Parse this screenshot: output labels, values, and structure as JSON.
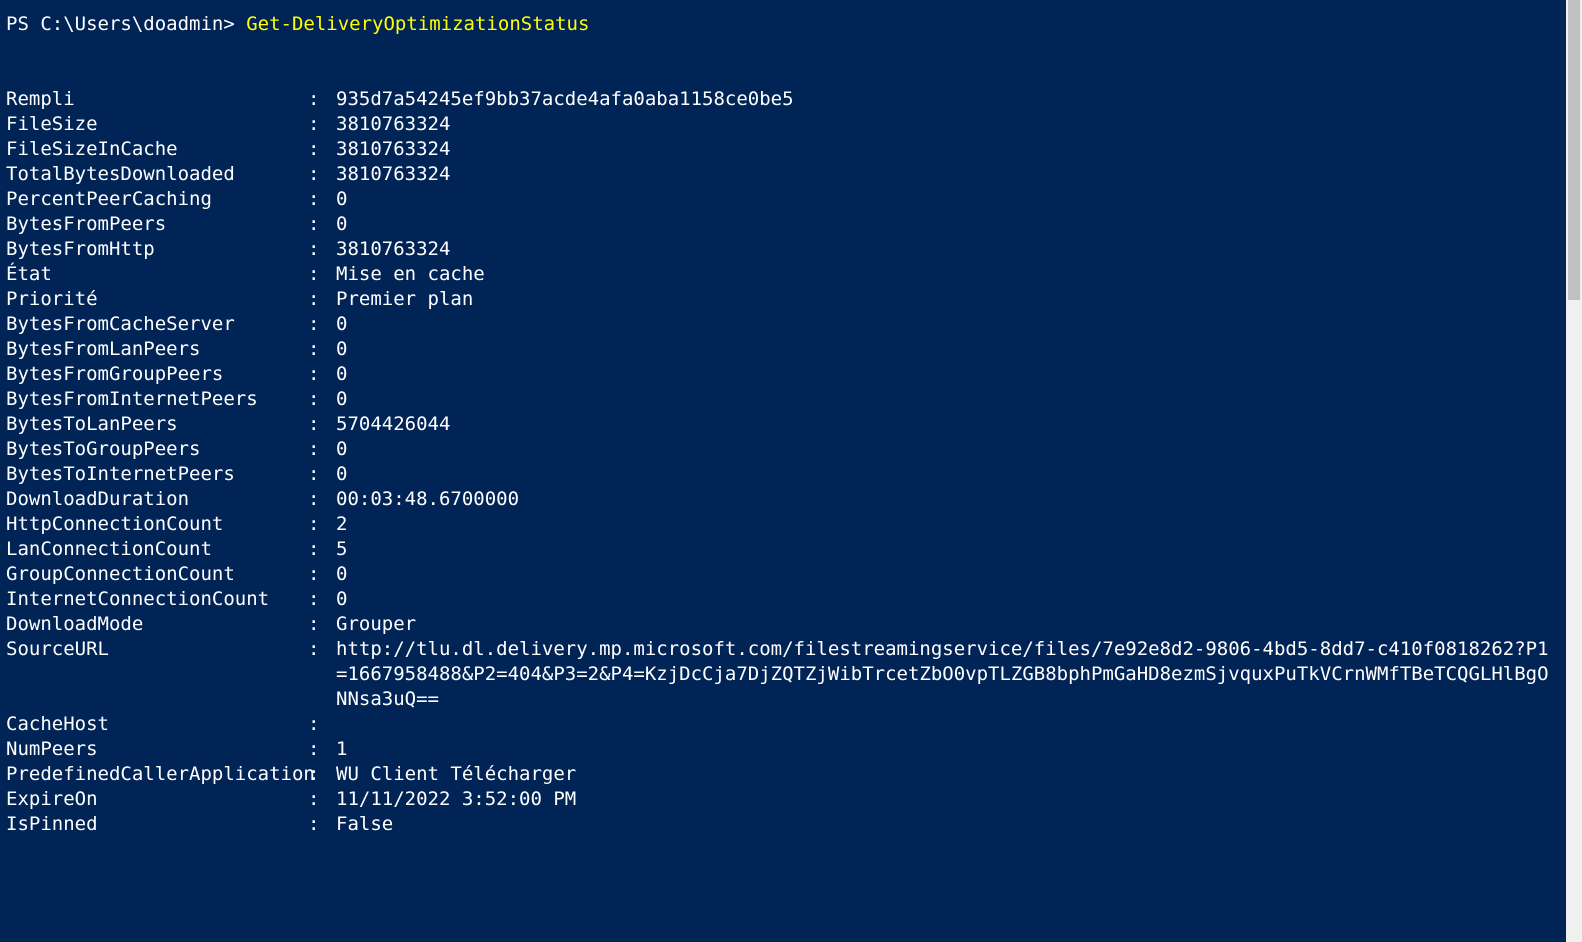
{
  "prompt": {
    "path": "PS C:\\Users\\doadmin> ",
    "command": "Get-DeliveryOptimizationStatus"
  },
  "records": [
    {
      "key": "Rempli",
      "value": "935d7a54245ef9bb37acde4afa0aba1158ce0be5"
    },
    {
      "key": "FileSize",
      "value": "3810763324"
    },
    {
      "key": "FileSizeInCache",
      "value": "3810763324"
    },
    {
      "key": "TotalBytesDownloaded",
      "value": "3810763324"
    },
    {
      "key": "PercentPeerCaching",
      "value": "0"
    },
    {
      "key": "BytesFromPeers",
      "value": "0"
    },
    {
      "key": "BytesFromHttp",
      "value": "3810763324"
    },
    {
      "key": "État",
      "value": "Mise en cache"
    },
    {
      "key": "Priorité",
      "value": " Premier plan"
    },
    {
      "key": "BytesFromCacheServer",
      "value": "0"
    },
    {
      "key": "BytesFromLanPeers",
      "value": "0"
    },
    {
      "key": "BytesFromGroupPeers",
      "value": "0"
    },
    {
      "key": "BytesFromInternetPeers",
      "value": "0"
    },
    {
      "key": "BytesToLanPeers",
      "value": "5704426044"
    },
    {
      "key": "BytesToGroupPeers",
      "value": "0"
    },
    {
      "key": "BytesToInternetPeers",
      "value": "0"
    },
    {
      "key": "DownloadDuration",
      "value": "00:03:48.6700000"
    },
    {
      "key": "HttpConnectionCount",
      "value": "2"
    },
    {
      "key": "LanConnectionCount",
      "value": "5"
    },
    {
      "key": "GroupConnectionCount",
      "value": "0"
    },
    {
      "key": "InternetConnectionCount",
      "value": "0"
    },
    {
      "key": "DownloadMode",
      "value": "Grouper"
    },
    {
      "key": "SourceURL",
      "value": "http://tlu.dl.delivery.mp.microsoft.com/filestreamingservice/files/7e92e8d2-9806-4bd5-8dd7-c410f0818262?P1=1667958488&P2=404&P3=2&P4=KzjDcCja7DjZQTZjWibTrcetZbO0vpTLZGB8bphPmGaHD8ezmSjvquxPuTkVCrnWMfTBeTCQGLHlBgONNsa3uQ=="
    },
    {
      "key": "CacheHost",
      "value": ""
    },
    {
      "key": "NumPeers",
      "value": "1"
    },
    {
      "key": "PredefinedCallerApplication",
      "value": "WU  Client    Télécharger"
    },
    {
      "key": "ExpireOn",
      "value": "11/11/2022 3:52:00 PM"
    },
    {
      "key": "IsPinned",
      "value": " False"
    }
  ],
  "separator": ":"
}
